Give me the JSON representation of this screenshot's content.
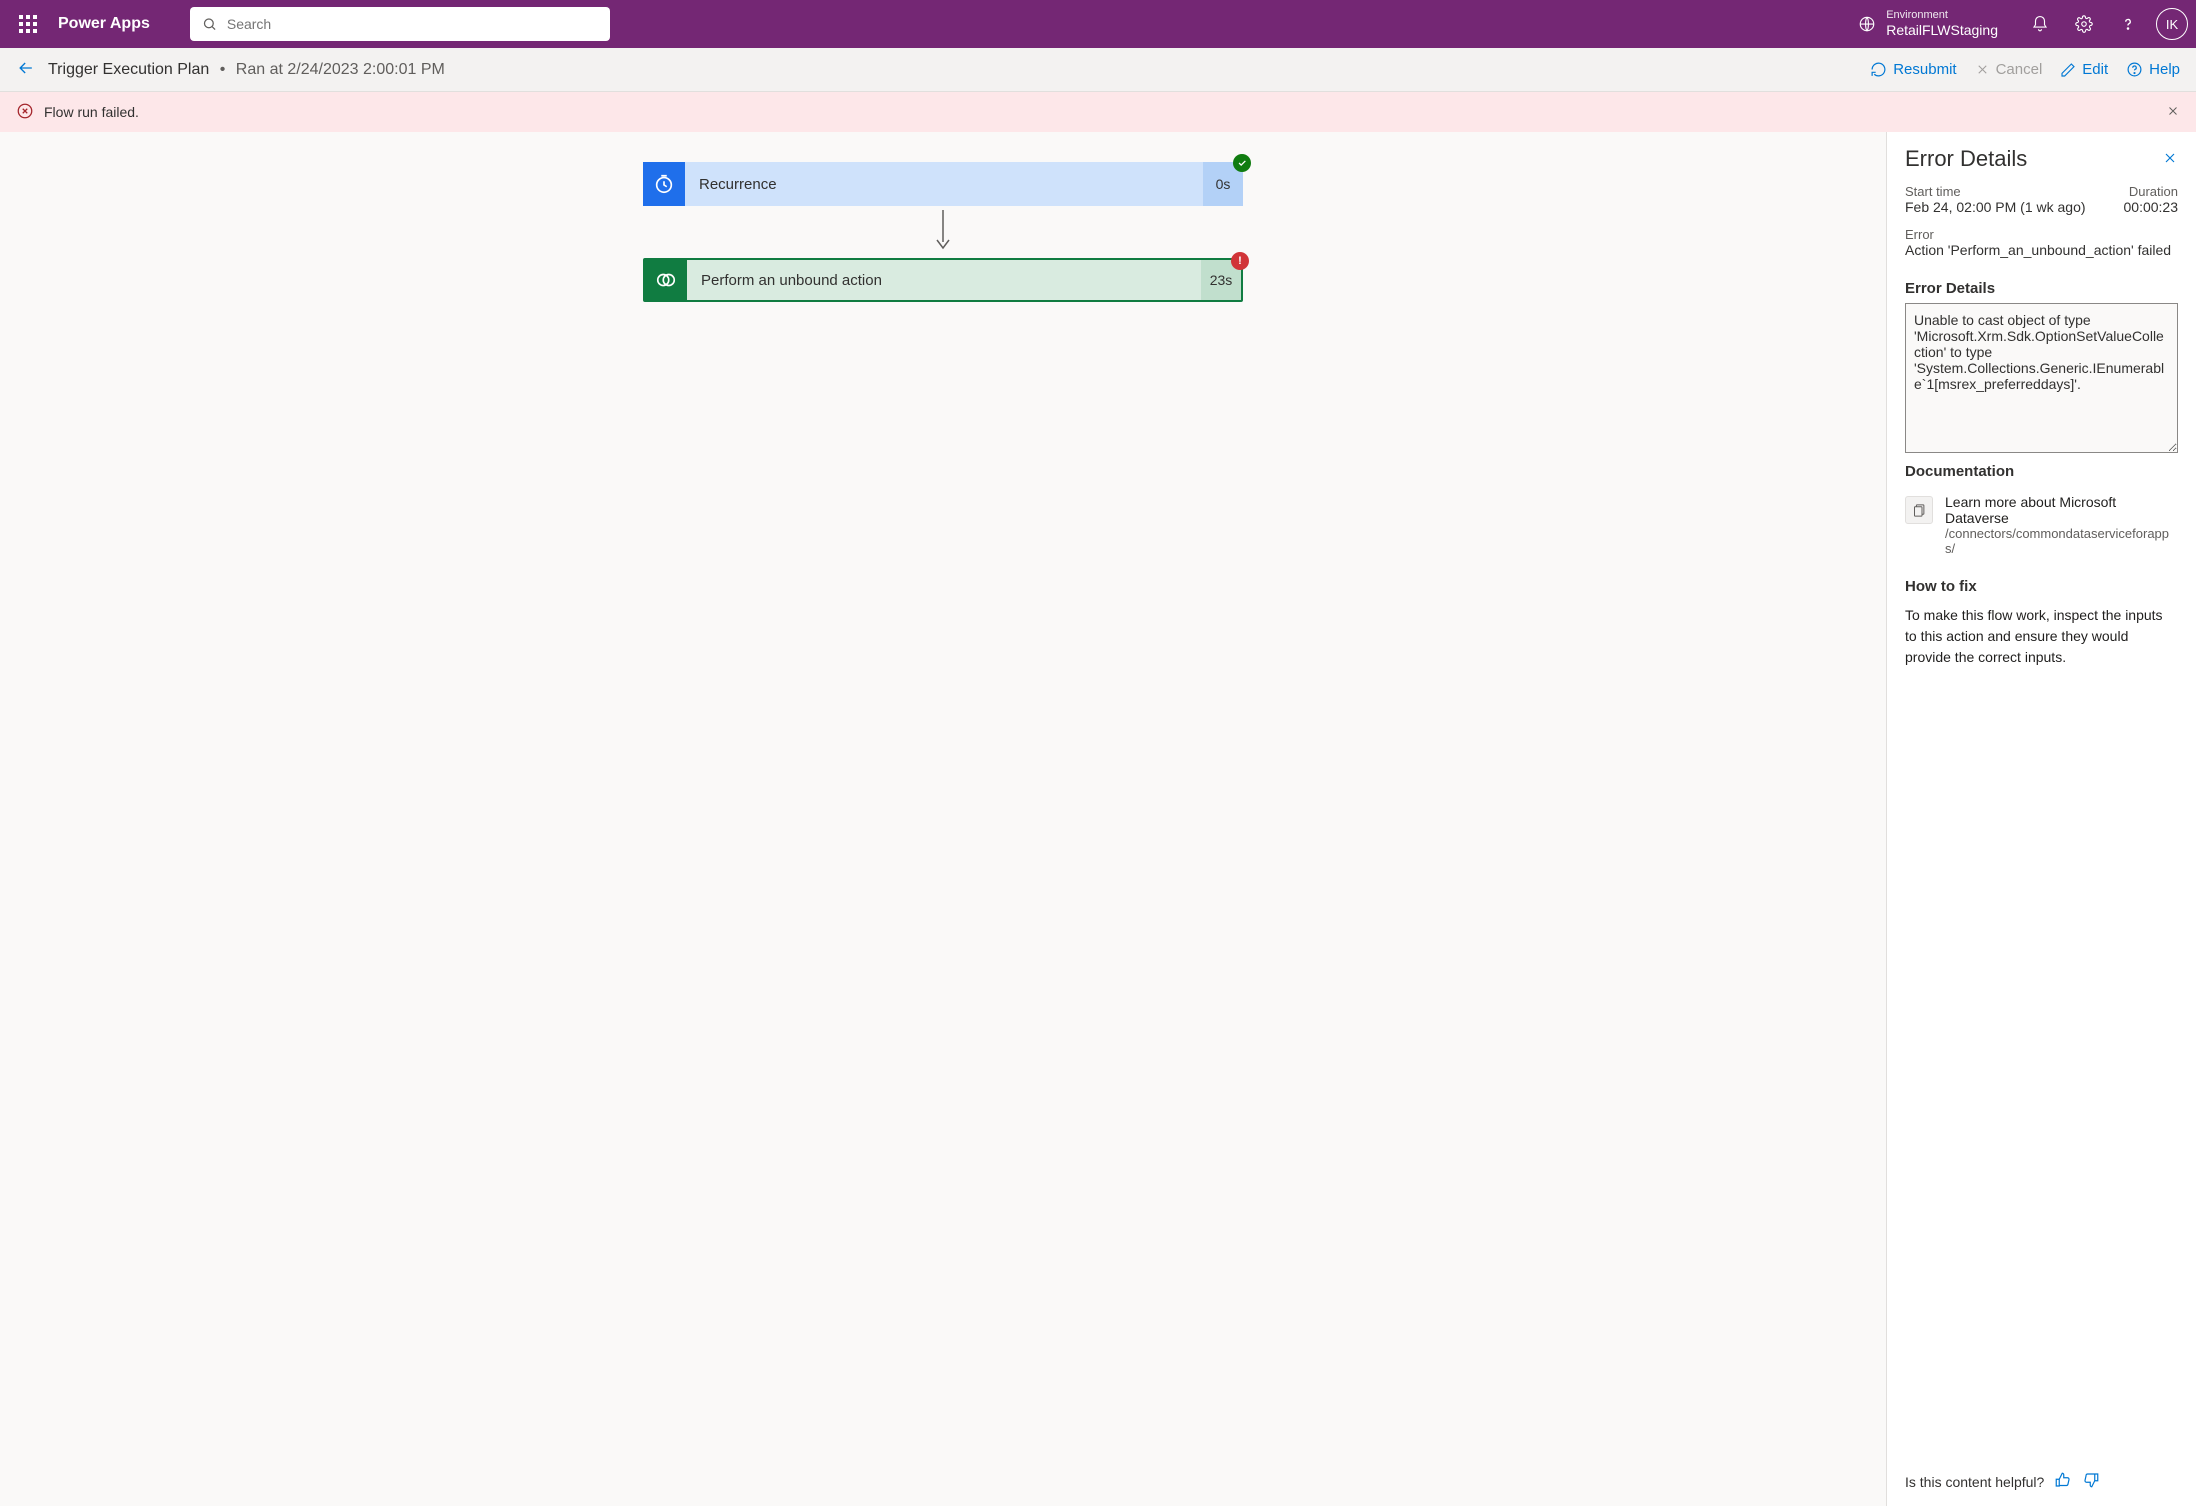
{
  "topbar": {
    "product": "Power Apps",
    "search_placeholder": "Search",
    "env_label": "Environment",
    "env_name": "RetailFLWStaging",
    "avatar": "IK"
  },
  "subbar": {
    "title": "Trigger Execution Plan",
    "ran_at": "Ran at 2/24/2023 2:00:01 PM",
    "resubmit": "Resubmit",
    "cancel": "Cancel",
    "edit": "Edit",
    "help": "Help"
  },
  "banner": {
    "message": "Flow run failed."
  },
  "flow": {
    "step1": {
      "name": "Recurrence",
      "duration": "0s"
    },
    "step2": {
      "name": "Perform an unbound action",
      "duration": "23s"
    }
  },
  "panel": {
    "title": "Error Details",
    "start_label": "Start time",
    "start_val": "Feb 24, 02:00 PM (1 wk ago)",
    "duration_label": "Duration",
    "duration_val": "00:00:23",
    "error_label": "Error",
    "error_val": "Action 'Perform_an_unbound_action' failed",
    "details_head": "Error Details",
    "details_text": "Unable to cast object of type 'Microsoft.Xrm.Sdk.OptionSetValueCollection' to type 'System.Collections.Generic.IEnumerable`1[msrex_preferreddays]'.",
    "doc_head": "Documentation",
    "doc_title": "Learn more about Microsoft Dataverse",
    "doc_path": "/connectors/commondataserviceforapps/",
    "howto_head": "How to fix",
    "howto_text": "To make this flow work, inspect the inputs to this action and ensure they would provide the correct inputs.",
    "feedback": "Is this content helpful?"
  }
}
